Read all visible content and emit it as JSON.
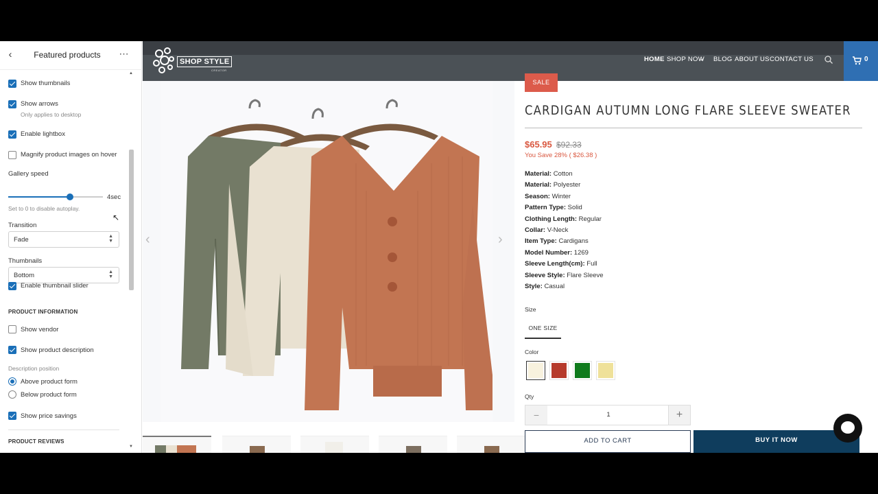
{
  "sidebar": {
    "title": "Featured products",
    "back_icon": "chevron-left-icon",
    "more_icon": "more-horizontal-icon",
    "settings": {
      "show_thumbnails": "Show thumbnails",
      "show_arrows": "Show arrows",
      "show_arrows_hint": "Only applies to desktop",
      "enable_lightbox": "Enable lightbox",
      "magnify": "Magnify product images on hover",
      "gallery_speed_label": "Gallery speed",
      "gallery_speed_value": "4sec",
      "gallery_speed_level": 0.65,
      "gallery_speed_hint": "Set to 0 to disable autoplay.",
      "transition_label": "Transition",
      "transition_value": "Fade",
      "thumbnails_label": "Thumbnails",
      "thumbnails_value": "Bottom",
      "enable_thumb_slider": "Enable thumbnail slider"
    },
    "product_info": {
      "heading": "PRODUCT INFORMATION",
      "show_vendor": "Show vendor",
      "show_description": "Show product description",
      "description_position_label": "Description position",
      "above_form": "Above product form",
      "below_form": "Below product form",
      "show_price_savings": "Show price savings"
    },
    "product_reviews_heading": "PRODUCT REVIEWS"
  },
  "store": {
    "logo_text": "SHOP STYLE",
    "logo_sub": "CREATOR",
    "nav": [
      "HOME",
      "SHOP NOW",
      "BLOG",
      "ABOUT US",
      "CONTACT US"
    ],
    "cart_count": "0",
    "sale_badge": "SALE",
    "product_title": "CARDIGAN AUTUMN LONG FLARE SLEEVE SWEATER",
    "price": "$65.95",
    "compare_price": "$92.33",
    "savings": "You Save 28% ( $26.38 )",
    "specs": [
      {
        "k": "Material:",
        "v": " Cotton"
      },
      {
        "k": "Material:",
        "v": " Polyester"
      },
      {
        "k": "Season:",
        "v": " Winter"
      },
      {
        "k": "Pattern Type:",
        "v": " Solid"
      },
      {
        "k": "Clothing Length:",
        "v": " Regular"
      },
      {
        "k": "Collar:",
        "v": " V-Neck"
      },
      {
        "k": "Item Type:",
        "v": " Cardigans"
      },
      {
        "k": "Model Number:",
        "v": " 1269"
      },
      {
        "k": "Sleeve Length(cm):",
        "v": " Full"
      },
      {
        "k": "Sleeve Style:",
        "v": " Flare Sleeve"
      },
      {
        "k": "Style:",
        "v": " Casual"
      }
    ],
    "size_label": "Size",
    "size_option": "ONE SIZE",
    "color_label": "Color",
    "colors": [
      "#f8f2de",
      "#b63a2b",
      "#0f7a1c",
      "#efe19a"
    ],
    "qty_label": "Qty",
    "qty_value": "1",
    "add_to_cart": "ADD TO CART",
    "buy_now": "BUY IT NOW"
  }
}
